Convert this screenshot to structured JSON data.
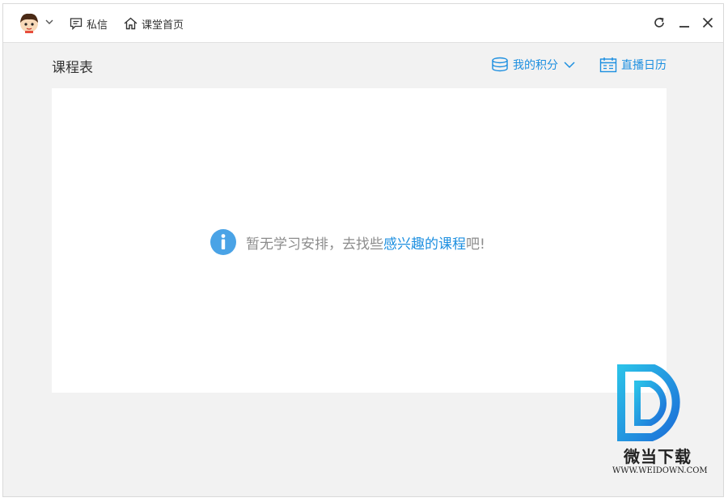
{
  "titlebar": {
    "avatar": "cartoon-avatar",
    "messages_label": "私信",
    "home_label": "课堂首页"
  },
  "page": {
    "title": "课程表",
    "points_label": "我的积分",
    "calendar_label": "直播日历"
  },
  "empty_state": {
    "text_before": "暂无学习安排，去找些",
    "link_text": "感兴趣的课程",
    "text_after": "吧!"
  },
  "watermark": {
    "name": "微当下载",
    "url": "WWW.WEIDOWN.COM"
  },
  "colors": {
    "accent": "#1c8fe0",
    "info_icon": "#4aa3e6",
    "background": "#f2f2f2"
  }
}
